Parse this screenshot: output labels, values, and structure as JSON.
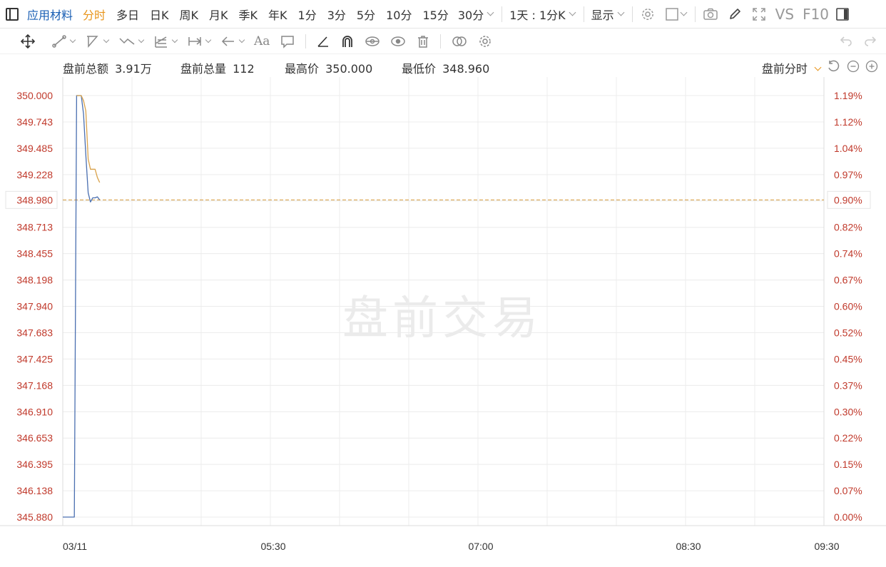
{
  "header": {
    "stock_name": "应用材料",
    "periods": [
      {
        "label": "分时",
        "active": true
      },
      {
        "label": "多日",
        "active": false
      },
      {
        "label": "日K",
        "active": false
      },
      {
        "label": "周K",
        "active": false
      },
      {
        "label": "月K",
        "active": false
      },
      {
        "label": "季K",
        "active": false
      },
      {
        "label": "年K",
        "active": false
      },
      {
        "label": "1分",
        "active": false
      },
      {
        "label": "3分",
        "active": false
      },
      {
        "label": "5分",
        "active": false
      },
      {
        "label": "10分",
        "active": false
      },
      {
        "label": "15分",
        "active": false
      }
    ],
    "more_period": "30分",
    "multi_period": "1天 : 1分K",
    "display_menu": "显示",
    "vs_label": "VS",
    "f10_label": "F10"
  },
  "toolbar": {
    "text_tool_label": "Aa",
    "icons": [
      "move-icon",
      "line-tool-icon",
      "channel-tool-icon",
      "wave-tool-icon",
      "fib-tool-icon",
      "measure-tool-icon",
      "arrow-tool-icon",
      "text-tool-icon",
      "comment-icon",
      "angle-icon",
      "magnet-icon",
      "eye-link-icon",
      "eye-icon",
      "trash-icon",
      "compare-icon",
      "settings-icon",
      "undo-icon",
      "redo-icon"
    ]
  },
  "stats": {
    "amount_label": "盘前总额",
    "amount_value": "3.91万",
    "volume_label": "盘前总量",
    "volume_value": "112",
    "high_label": "最高价",
    "high_value": "350.000",
    "low_label": "最低价",
    "low_value": "348.960",
    "mode_select": "盘前分时"
  },
  "chart_data": {
    "type": "line",
    "watermark": "盘前交易",
    "date_label": "03/11",
    "x_tick_labels": [
      "03/11",
      "05:30",
      "07:00",
      "08:30",
      "09:30"
    ],
    "x_range": [
      "04:00",
      "09:30"
    ],
    "y_tick_labels": [
      "350.000",
      "349.743",
      "349.485",
      "349.228",
      "348.980",
      "348.713",
      "348.455",
      "348.198",
      "347.940",
      "347.683",
      "347.425",
      "347.168",
      "346.910",
      "346.653",
      "346.395",
      "346.138",
      "345.880"
    ],
    "y_pct_labels": [
      "1.19%",
      "1.12%",
      "1.04%",
      "0.97%",
      "0.90%",
      "0.82%",
      "0.74%",
      "0.67%",
      "0.60%",
      "0.52%",
      "0.45%",
      "0.37%",
      "0.30%",
      "0.22%",
      "0.15%",
      "0.07%",
      "0.00%"
    ],
    "ylim": [
      345.88,
      350.0
    ],
    "highlight_value": "348.980",
    "highlight_pct": "0.90%",
    "reference_price": 348.98,
    "grid": true,
    "colors": {
      "price_line": "#4a6fb0",
      "avg_line": "#d9a24b",
      "axis_text": "#c0392b",
      "reference_line": "#d9a24b",
      "grid": "#ececec",
      "active_period": "#e8941a"
    },
    "series": [
      {
        "x": [
          "04:00",
          "04:02",
          "04:03",
          "04:04",
          "04:05",
          "04:06",
          "04:07",
          "04:08",
          "04:09",
          "04:10",
          "04:11",
          "04:12",
          "04:13",
          "04:14",
          "04:15",
          "04:16"
        ],
        "values": [
          345.88,
          345.88,
          345.88,
          345.88,
          345.88,
          350.0,
          350.0,
          350.0,
          349.82,
          349.42,
          349.05,
          348.96,
          349.0,
          349.0,
          349.01,
          348.98
        ]
      },
      {
        "x": [
          "04:06",
          "04:07",
          "04:08",
          "04:09",
          "04:10",
          "04:11",
          "04:12",
          "04:13",
          "04:14",
          "04:15",
          "04:16"
        ],
        "values": [
          350.0,
          350.0,
          350.0,
          349.95,
          349.85,
          349.38,
          349.28,
          349.28,
          349.28,
          349.2,
          349.15
        ]
      }
    ]
  }
}
